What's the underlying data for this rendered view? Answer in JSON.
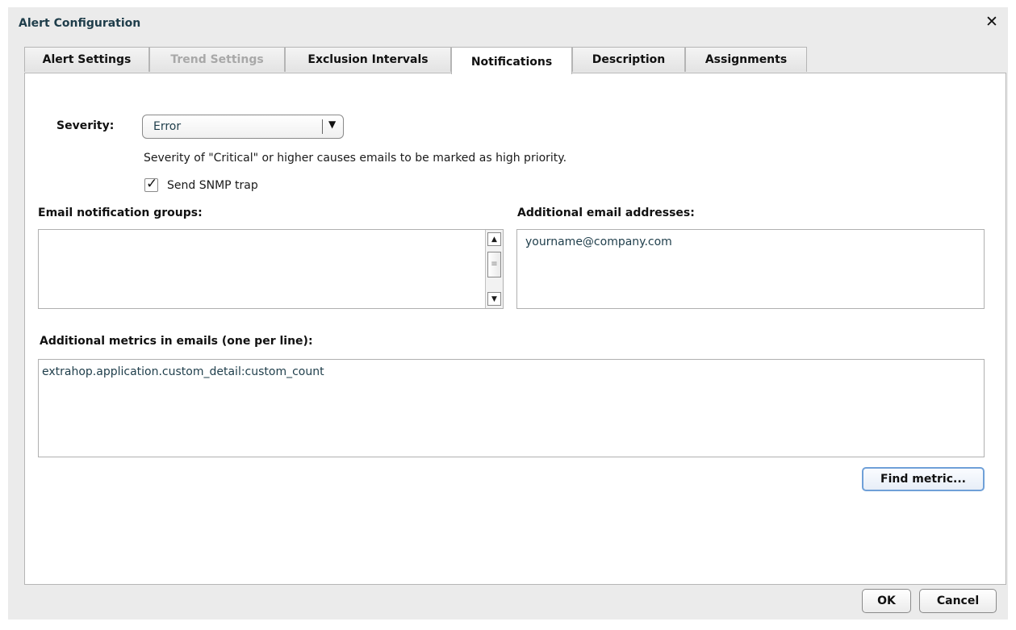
{
  "window": {
    "title": "Alert Configuration",
    "close_icon": "close-icon"
  },
  "tabs": [
    {
      "label": "Alert Settings",
      "state": "normal"
    },
    {
      "label": "Trend Settings",
      "state": "disabled"
    },
    {
      "label": "Exclusion Intervals",
      "state": "normal"
    },
    {
      "label": "Notifications",
      "state": "active"
    },
    {
      "label": "Description",
      "state": "normal"
    },
    {
      "label": "Assignments",
      "state": "normal"
    }
  ],
  "severity": {
    "label": "Severity:",
    "selected": "Error",
    "note": "Severity of \"Critical\" or higher causes emails to be marked as high priority."
  },
  "snmp": {
    "label": "Send SNMP trap",
    "checked": true,
    "check_glyph": "✓"
  },
  "email_groups": {
    "label": "Email notification groups:",
    "items": []
  },
  "additional_emails": {
    "label": "Additional email addresses:",
    "value": "yourname@company.com"
  },
  "metrics": {
    "label": "Additional metrics in emails (one per line):",
    "value": "extrahop.application.custom_detail:custom_count"
  },
  "buttons": {
    "find_metric": "Find metric...",
    "ok": "OK",
    "cancel": "Cancel"
  },
  "scrollbar": {
    "up_glyph": "▲",
    "down_glyph": "▼",
    "thumb_glyph": "≡"
  },
  "select_arrow_glyph": "▼",
  "close_glyph": "✕",
  "colors": {
    "dialog_bg": "#ebebeb",
    "title": "#1e3d4a",
    "focus_border": "#6fa0d8",
    "disabled_text": "#a8a8a8"
  }
}
